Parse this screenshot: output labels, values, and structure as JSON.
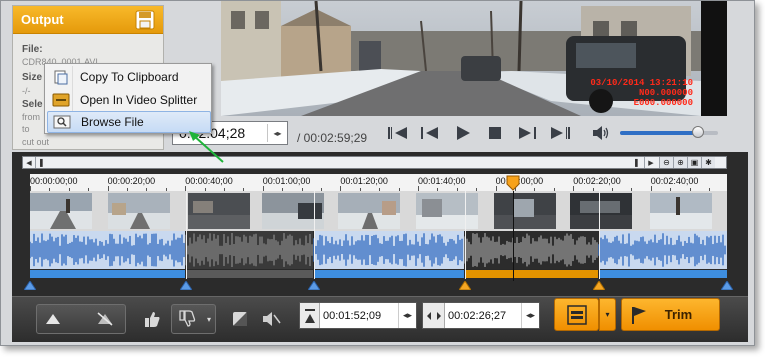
{
  "output_panel": {
    "title": "Output",
    "file_label": "File:",
    "file_value": "CDR840_0001.AVI",
    "size_label": "Size",
    "size_value": "-/-",
    "select_label": "Sele",
    "from_text": "from",
    "to_text": "to",
    "cut_text": "cut out"
  },
  "context_menu": {
    "items": [
      {
        "label": "Copy To Clipboard",
        "icon": "clipboard-icon"
      },
      {
        "label": "Open In Video Splitter",
        "icon": "video-splitter-icon"
      },
      {
        "label": "Browse File",
        "icon": "browse-file-icon"
      }
    ],
    "highlighted_index": 2
  },
  "video": {
    "timestamp_line1": "03/10/2014 13:21:10",
    "timestamp_line2": "N00.000000",
    "timestamp_line3": "E000.000000"
  },
  "transport": {
    "current_time": "0:02:04;28",
    "total_time": "/ 00:02:59;29",
    "volume_level": 0.8
  },
  "timeline": {
    "tick_labels": [
      "00:00:00;00",
      "00:00:20;00",
      "00:00:40;00",
      "00:01:00;00",
      "00:01:20;00",
      "00:01:40;00",
      "00:02:00;00",
      "00:02:20;00",
      "00:02:40;00"
    ],
    "playhead_position_fraction": 0.69
  },
  "bottom_bar": {
    "start_time": "00:01:52;09",
    "end_time": "00:02:26;27",
    "trim_label": "Trim"
  },
  "colors": {
    "accent_orange": "#f5a623",
    "waveform_blue": "#3f74c4",
    "selection_blue": "#3e8ee0",
    "timestamp_red": "#ff2a1a"
  }
}
